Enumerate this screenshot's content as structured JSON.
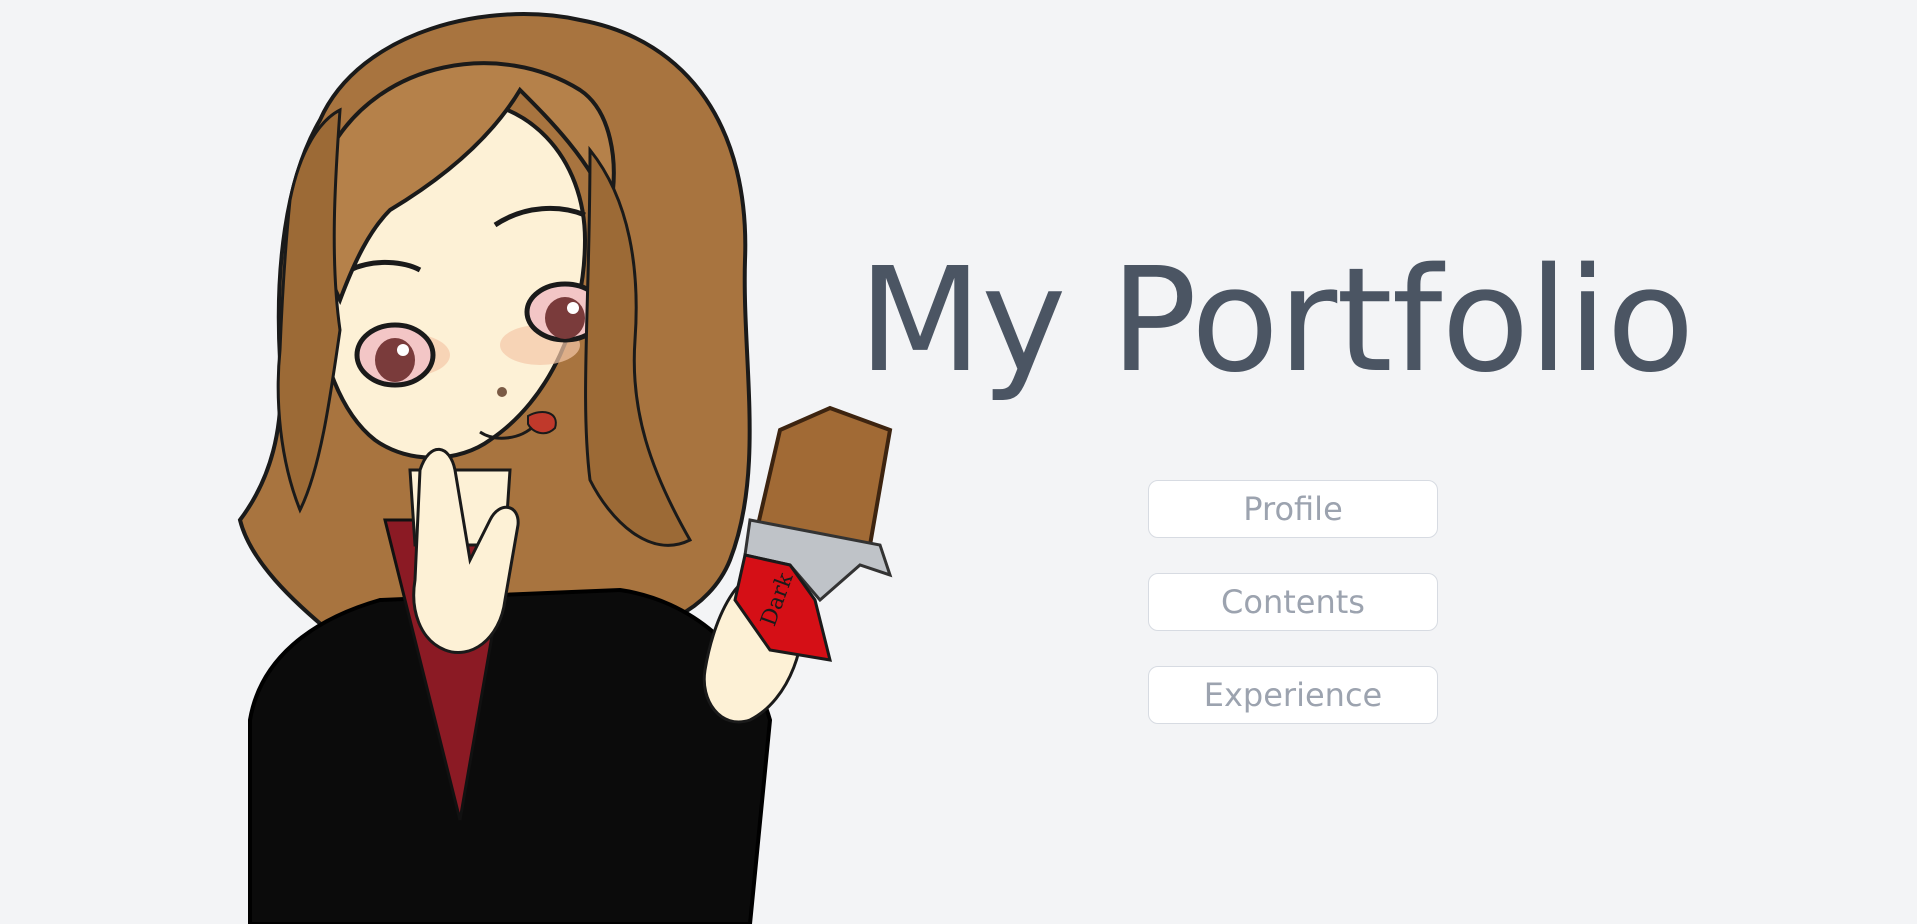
{
  "header": {
    "title": "My Portfolio"
  },
  "nav": {
    "items": [
      {
        "label": "Profile"
      },
      {
        "label": "Contents"
      },
      {
        "label": "Experience"
      }
    ]
  },
  "illustration": {
    "description_icon": "anime-girl-with-chocolate-illustration",
    "wrapper_text": "Dark"
  },
  "colors": {
    "background": "#f3f4f6",
    "title": "#4b5563",
    "button_text": "#9ca3af",
    "button_border": "#d7dbe2"
  }
}
